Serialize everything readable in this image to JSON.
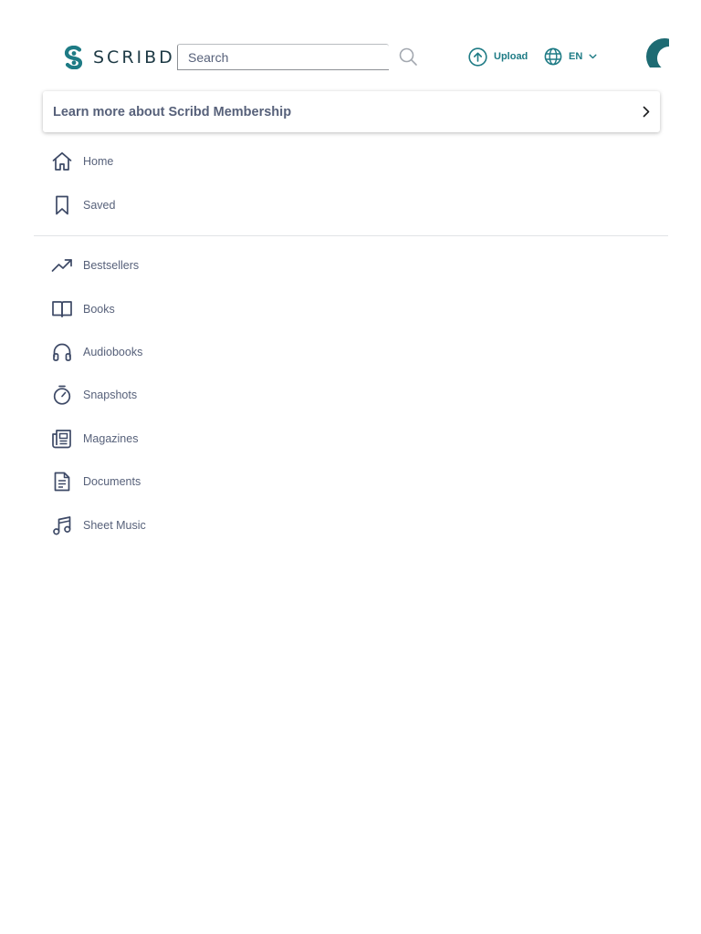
{
  "brand": {
    "name": "SCRIBD",
    "accent": "#1e7b85",
    "logo_icon": "scribd-s-logo-icon"
  },
  "header": {
    "search": {
      "placeholder": "Search",
      "value": ""
    },
    "upload_label": "Upload",
    "language_label": "EN"
  },
  "membership_banner": {
    "label": "Learn more about Scribd Membership"
  },
  "nav_primary": [
    {
      "label": "Home",
      "icon": "home-icon"
    },
    {
      "label": "Saved",
      "icon": "bookmark-icon"
    }
  ],
  "nav_categories": [
    {
      "label": "Bestsellers",
      "icon": "trending-up-icon"
    },
    {
      "label": "Books",
      "icon": "open-book-icon"
    },
    {
      "label": "Audiobooks",
      "icon": "headphones-icon"
    },
    {
      "label": "Snapshots",
      "icon": "stopwatch-icon"
    },
    {
      "label": "Magazines",
      "icon": "newspaper-icon"
    },
    {
      "label": "Documents",
      "icon": "document-icon"
    },
    {
      "label": "Sheet Music",
      "icon": "music-note-icon"
    }
  ]
}
